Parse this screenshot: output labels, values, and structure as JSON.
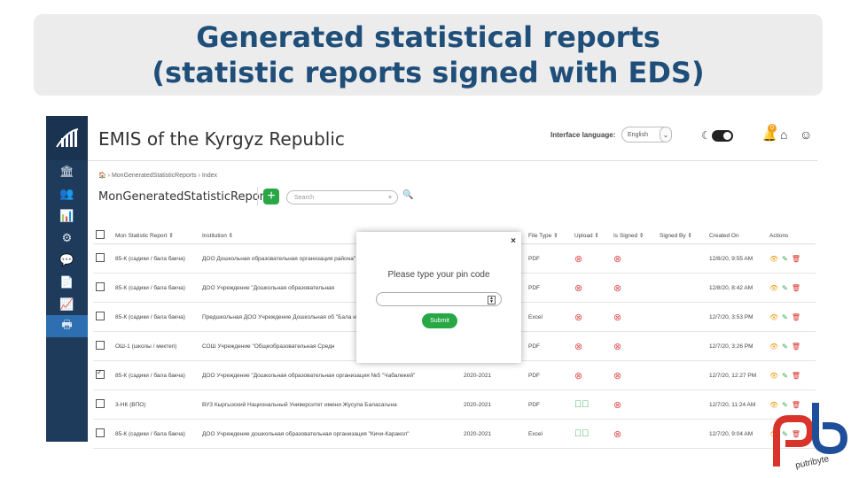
{
  "banner": {
    "line1": "Generated statistical reports",
    "line2": "(statistic reports signed with EDS)"
  },
  "app": {
    "title": "EMIS of the Kyrgyz Republic",
    "interface_language_label": "Interface language:",
    "language_value": "English",
    "notification_count": "0"
  },
  "sidebar": {
    "icons": [
      "bank-icon",
      "users-icon",
      "bar-chart-icon",
      "gears-icon",
      "chat-icon",
      "document-icon",
      "line-chart-icon",
      "print-icon"
    ]
  },
  "breadcrumb": {
    "home_icon": "home-icon",
    "items": [
      "MonGeneratedStatisticReports",
      "Index"
    ]
  },
  "page": {
    "heading": "MonGeneratedStatisticReports",
    "search_placeholder": "Search"
  },
  "table": {
    "headers": [
      "Mon Statistic Report",
      "Institution",
      "File Type",
      "Upload",
      "Is Signed",
      "Signed By",
      "Created On",
      "Actions"
    ],
    "rows": [
      {
        "checked": false,
        "report": "85-К (садики / бала бакча)",
        "institution": "ДОО Дошкольная образовательная организация района\"",
        "year": "",
        "file_type": "PDF",
        "upload": "bad",
        "signed": "bad",
        "signed_by": "",
        "created": "12/8/20, 9:55 AM"
      },
      {
        "checked": false,
        "report": "85-К (садики / бала бакча)",
        "institution": "ДОО Учреждение \"Дошкольная образовательная",
        "year": "",
        "file_type": "PDF",
        "upload": "bad",
        "signed": "bad",
        "signed_by": "",
        "created": "12/8/20, 8:42 AM"
      },
      {
        "checked": false,
        "report": "85-К (садики / бала бакча)",
        "institution": "Предшкольная ДОО Учреждение Дошкольная об \"Бала нур\"",
        "year": "",
        "file_type": "Excel",
        "upload": "bad",
        "signed": "bad",
        "signed_by": "",
        "created": "12/7/20, 3:53 PM"
      },
      {
        "checked": false,
        "report": "ОШ-1 (школы / мектеп)",
        "institution": "СОШ Учреждение \"Общеобразовательная Средн",
        "year": "",
        "file_type": "PDF",
        "upload": "bad",
        "signed": "bad",
        "signed_by": "",
        "created": "12/7/20, 3:26 PM"
      },
      {
        "checked": true,
        "report": "85-К (садики / бала бакча)",
        "institution": "ДОО Учреждение \"Дошкольная образовательная организация №5 \"Чабалекей\"",
        "year": "2020-2021",
        "file_type": "PDF",
        "upload": "bad",
        "signed": "bad",
        "signed_by": "",
        "created": "12/7/20, 12:27 PM"
      },
      {
        "checked": false,
        "report": "3-НК (ВПО)",
        "institution": "ВУЗ Кыргызский Национальный Университет имени Жусупа Баласагына",
        "year": "2020-2021",
        "file_type": "PDF",
        "upload": "ok",
        "signed": "bad",
        "signed_by": "",
        "created": "12/7/20, 11:24 AM"
      },
      {
        "checked": false,
        "report": "85-К (садики / бала бакча)",
        "institution": "ДОО Учреждение дошкольная образовательная организация \"Кичи-Каракол\"",
        "year": "2020-2021",
        "file_type": "Excel",
        "upload": "ok",
        "signed": "bad",
        "signed_by": "",
        "created": "12/7/20, 9:04 AM"
      }
    ]
  },
  "modal": {
    "prompt": "Please type your pin code",
    "submit_label": "Submit",
    "close_glyph": "×"
  },
  "brand": {
    "logo_text": "putribyte",
    "red": "#d9342b",
    "blue": "#1f4e9a"
  },
  "colors": {
    "sidebar": "#1f3b5c",
    "accent": "#2d6fb0",
    "success": "#28a745",
    "danger": "#e05454"
  }
}
